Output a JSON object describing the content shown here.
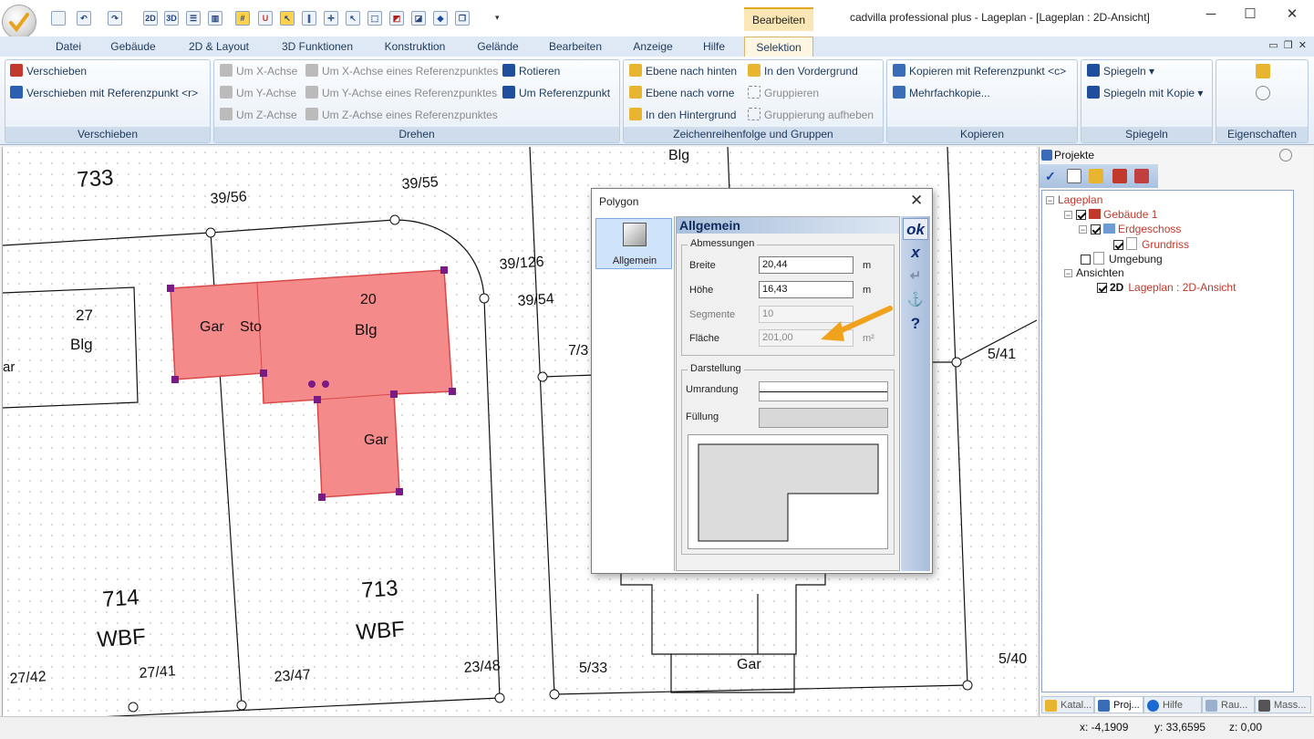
{
  "window": {
    "title": "cadvilla professional plus - Lageplan - [Lageplan : 2D-Ansicht]",
    "context_tab_group": "Bearbeiten",
    "qat": [
      "2D",
      "3D"
    ]
  },
  "menu": {
    "tabs": [
      "Datei",
      "Gebäude",
      "2D & Layout",
      "3D Funktionen",
      "Konstruktion",
      "Gelände",
      "Bearbeiten",
      "Anzeige",
      "Hilfe",
      "Selektion"
    ],
    "active": "Selektion"
  },
  "ribbon": {
    "verschieben": {
      "label": "Verschieben",
      "items": [
        "Verschieben",
        "Verschieben mit Referenzpunkt <r>"
      ]
    },
    "drehen": {
      "label": "Drehen",
      "items": [
        "Um X-Achse",
        "Um Y-Achse",
        "Um Z-Achse",
        "Um X-Achse eines Referenzpunktes",
        "Um Y-Achse eines Referenzpunktes",
        "Um Z-Achse eines Referenzpunktes",
        "Rotieren",
        "Um Referenzpunkt"
      ]
    },
    "zeichen": {
      "label": "Zeichenreihenfolge und Gruppen",
      "items": [
        "Ebene nach hinten",
        "Ebene nach vorne",
        "In den Hintergrund",
        "In den Vordergrund",
        "Gruppieren",
        "Gruppierung aufheben"
      ]
    },
    "kopieren": {
      "label": "Kopieren",
      "items": [
        "Kopieren mit Referenzpunkt <c>",
        "Mehrfachkopie..."
      ]
    },
    "spiegeln": {
      "label": "Spiegeln",
      "items": [
        "Spiegeln",
        "Spiegeln mit Kopie"
      ]
    },
    "eigenschaften": {
      "label": "Eigenschaften"
    }
  },
  "map_labels": {
    "l733": "733",
    "l39_56": "39/56",
    "l39_55": "39/55",
    "l39_126": "39/126",
    "l39_54": "39/54",
    "l27": "27",
    "lBlg1": "Blg",
    "lar": "ar",
    "lGar1": "Gar",
    "lSto": "Sto",
    "l20": "20",
    "lBlg2": "Blg",
    "lGar2": "Gar",
    "l7_3": "7/3",
    "lBlgTop": "Blg",
    "l5_41": "5/41",
    "l714": "714",
    "lWBF1": "WBF",
    "l713": "713",
    "lWBF2": "WBF",
    "l27_42": "27/42",
    "l27_41": "27/41",
    "l23_47": "23/47",
    "l23_48": "23/48",
    "l5_33": "5/33",
    "lGar3": "Gar",
    "l5_40": "5/40"
  },
  "dialog": {
    "title": "Polygon",
    "nav_item": "Allgemein",
    "heading": "Allgemein",
    "abmessungen_legend": "Abmessungen",
    "breite_label": "Breite",
    "breite_value": "20,44",
    "breite_unit": "m",
    "hoehe_label": "Höhe",
    "hoehe_value": "16,43",
    "hoehe_unit": "m",
    "segmente_label": "Segmente",
    "segmente_value": "10",
    "flaeche_label": "Fläche",
    "flaeche_value": "201,00",
    "flaeche_unit": "m²",
    "darstellung_legend": "Darstellung",
    "umrandung_label": "Umrandung",
    "fuellung_label": "Füllung",
    "ok_label": "ok",
    "cancel_label": "x",
    "help_label": "?"
  },
  "projects_panel": {
    "title": "Projekte",
    "tree": {
      "lageplan": "Lageplan",
      "gebaeude": "Gebäude 1",
      "erdgeschoss": "Erdgeschoss",
      "grundriss": "Grundriss",
      "umgebung": "Umgebung",
      "ansichten": "Ansichten",
      "ansicht_prefix": "2D",
      "ansicht": "Lageplan : 2D-Ansicht"
    },
    "tabs": [
      "Katal...",
      "Proj...",
      "Hilfe",
      "Rau...",
      "Mass..."
    ],
    "active_tab": "Proj..."
  },
  "status": {
    "x": "x: -4,1909",
    "y": "y: 33,6595",
    "z": "z: 0,00"
  },
  "colors": {
    "building_fill": "#f48a8a",
    "accent": "#e2a922",
    "arrow": "#f0a21c"
  }
}
